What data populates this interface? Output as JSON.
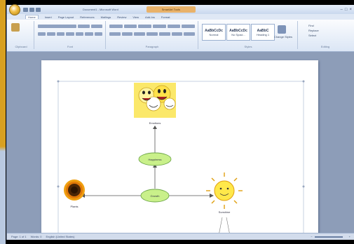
{
  "titlebar": {
    "title": "Document1 - Microsoft Word",
    "context_tab": "SmartArt Tools"
  },
  "tabs": [
    "Home",
    "Insert",
    "Page Layout",
    "References",
    "Mailings",
    "Review",
    "View",
    "Add-Ins",
    "Format"
  ],
  "ribbon": {
    "groups": [
      "Clipboard",
      "Font",
      "Paragraph",
      "Styles",
      "Editing"
    ],
    "styles": [
      {
        "sample": "AaBbCcDc",
        "name": "Normal"
      },
      {
        "sample": "AaBbCcDc",
        "name": "No Spaci..."
      },
      {
        "sample": "AaBbC",
        "name": "Heading 1"
      }
    ],
    "change_styles": "Change Styles",
    "editing_items": [
      "Find",
      "Replace",
      "Select"
    ]
  },
  "diagram": {
    "nodes": {
      "top_label": "Emotions",
      "middle_label": "Happiness",
      "center_label": "Growth",
      "left_label": "Plants",
      "right_label": "Sunshine"
    },
    "colors": {
      "node_fill": "#c9f08a",
      "node_stroke": "#6fa84a",
      "sun": "#ffe84a",
      "flower": "#f0a010"
    }
  },
  "status": {
    "page": "Page: 1 of 1",
    "words": "Words: 0",
    "language": "English (United States)"
  }
}
